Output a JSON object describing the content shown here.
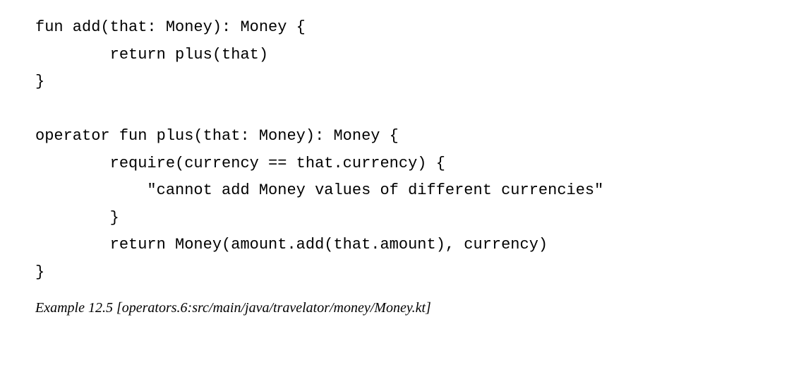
{
  "code": {
    "line1": "fun add(that: Money): Money {",
    "line2": "        return plus(that)",
    "line3": "}",
    "line4": "",
    "line5": "operator fun plus(that: Money): Money {",
    "line6": "        require(currency == that.currency) {",
    "line7": "            \"cannot add Money values of different currencies\"",
    "line8": "        }",
    "line9": "        return Money(amount.add(that.amount), currency)",
    "line10": "}"
  },
  "caption": "Example 12.5 [operators.6:src/main/java/travelator/money/Money.kt]"
}
